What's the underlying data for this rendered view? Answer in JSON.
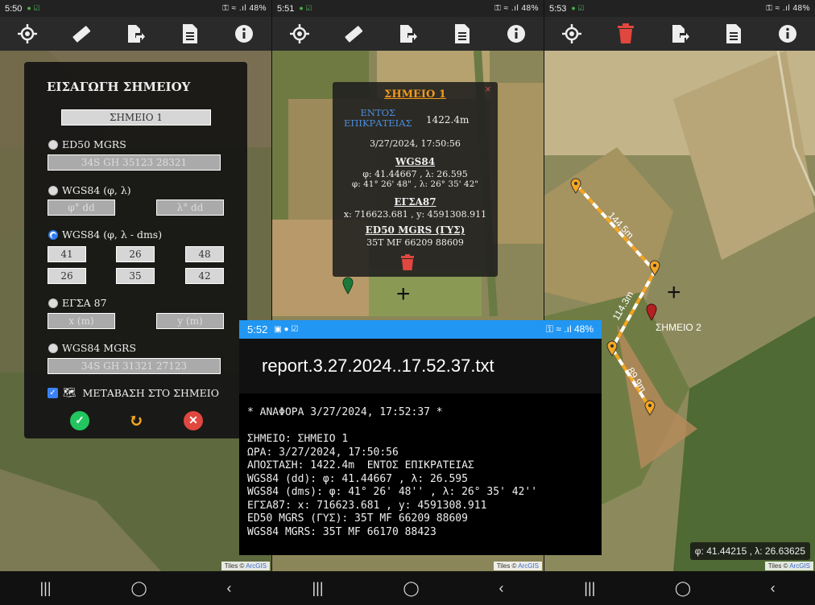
{
  "screens": [
    {
      "status_time": "5:50",
      "status_right": "⚿ ≈ .ıl 48%"
    },
    {
      "status_time": "5:51",
      "status_right": "⚿ ≈ .ıl 48%"
    },
    {
      "status_time": "5:53",
      "status_right": "⚿ ≈ .ıl 48%"
    }
  ],
  "toolbar_icons": [
    "locate-icon",
    "ruler-icon",
    "export-icon",
    "document-icon",
    "info-icon"
  ],
  "toolbar_icons_s3": [
    "locate-icon",
    "trash-icon",
    "export-icon",
    "document-icon",
    "info-icon"
  ],
  "nav_icons": [
    "recent-apps-icon",
    "home-icon",
    "back-icon"
  ],
  "tiles_prefix": "Tiles ©",
  "tiles_link": "ArcGIS",
  "point_form": {
    "title": "ΕΙΣΑΓΩΓΗ ΣΗΜΕΙΟΥ",
    "name_value": "ΣΗΜΕΙΟ 1",
    "ed50_label": "ED50 MGRS",
    "ed50_value": "34S GH 35123 28321",
    "wgs84_dd_label": "WGS84 (φ, λ)",
    "phi_placeholder": "φ° dd",
    "lambda_placeholder": "λ° dd",
    "wgs84_dms_label": "WGS84 (φ, λ - dms)",
    "dms_row1": [
      "41",
      "26",
      "48"
    ],
    "dms_row2": [
      "26",
      "35",
      "42"
    ],
    "egsa_label": "ΕΓΣΑ 87",
    "x_placeholder": "x (m)",
    "y_placeholder": "y (m)",
    "wgs84_mgrs_label": "WGS84 MGRS",
    "wgs84_mgrs_value": "34S GH 31321 27123",
    "goto_label": "ΜΕΤΑΒΑΣΗ ΣΤΟ ΣΗΜΕΙΟ",
    "goto_checked": true,
    "accept_color": "#22c55e",
    "reset_color": "#f5a623",
    "cancel_color": "#e0473e"
  },
  "popup": {
    "title": "ΣΗΜΕΙΟ 1",
    "close": "×",
    "zone_line1": "ΕΝΤΟΣ",
    "zone_line2": "ΕΠΙΚΡΑΤΕΙΑΣ",
    "distance": "1422.4m",
    "datetime": "3/27/2024, 17:50:56",
    "wgs84_header": "WGS84",
    "wgs84_dd": "φ: 41.44667 , λ: 26.595",
    "wgs84_dms": "φ: 41° 26' 48\" , λ: 26° 35' 42\"",
    "egsa_header": "ΕΓΣΑ87",
    "egsa_value": "x: 716623.681 , y: 4591308.911",
    "ed50_header": "ED50 MGRS (ΓΥΣ)",
    "ed50_value": "35T MF 66209 88609",
    "zone_color": "#4a90e2"
  },
  "report": {
    "time": "5:52",
    "status_right": "⚿ ≈ .ıl 48%",
    "filename": "report.3.27.2024..17.52.37.txt",
    "lines": [
      "* ΑΝΑΦΟΡΑ 3/27/2024, 17:52:37 *",
      "",
      "ΣΗΜΕΙΟ: ΣΗΜΕΙΟ 1",
      "ΩΡΑ: 3/27/2024, 17:50:56",
      "ΑΠΟΣΤΑΣΗ: 1422.4m  ΕΝΤΟΣ ΕΠΙΚΡΑΤΕΙΑΣ",
      "WGS84 (dd): φ: 41.44667 , λ: 26.595",
      "WGS84 (dms): φ: 41° 26' 48'' , λ: 26° 35' 42''",
      "ΕΓΣΑ87: x: 716623.681 , y: 4591308.911",
      "ED50 MGRS (ΓΥΣ): 35T MF 66209 88609",
      "WGS84 MGRS: 35T MF 66170 88423"
    ]
  },
  "measure": {
    "segment_labels": [
      "144.5m",
      "114.3m",
      "89.9m"
    ],
    "point_label": "ΣΗΜΕΙΟ 2",
    "coords": "φ: 41.44215 , λ: 26.63625",
    "line_color": "#f5a623",
    "marker_color": "#f5a623",
    "point_marker_color": "#b22222"
  }
}
